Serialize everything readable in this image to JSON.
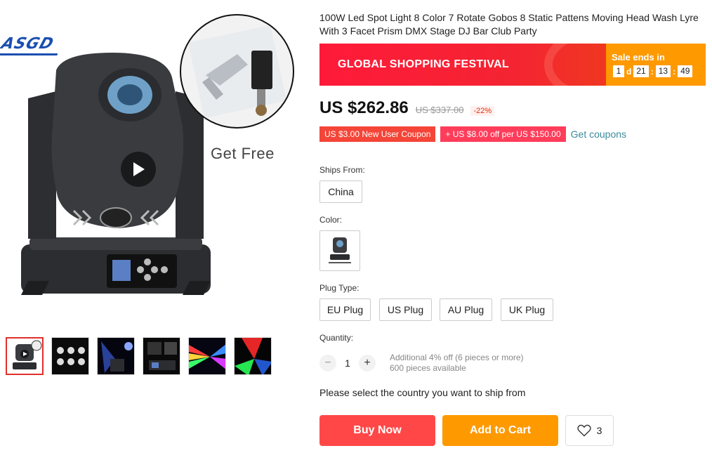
{
  "gallery": {
    "brand": "ASGD",
    "inset_caption": "Get Free",
    "thumbnails": [
      {
        "name": "thumb-moving-head"
      },
      {
        "name": "thumb-gobos"
      },
      {
        "name": "thumb-light-effect"
      },
      {
        "name": "thumb-display-panel"
      },
      {
        "name": "thumb-rainbow-beams"
      },
      {
        "name": "thumb-red-green-beams"
      }
    ]
  },
  "product": {
    "title": "100W Led Spot Light 8 Color 7 Rotate Gobos 8 Static Pattens Moving Head Wash Lyre With 3 Facet Prism DMX Stage DJ Bar Club Party"
  },
  "banner": {
    "title": "GLOBAL SHOPPING FESTIVAL",
    "sale_label": "Sale ends in",
    "days": "1",
    "days_unit": "d",
    "hours": "21",
    "minutes": "13",
    "seconds": "49",
    "sep": ":"
  },
  "price": {
    "current": "US $262.86",
    "original": "US $337.00",
    "discount": "-22%"
  },
  "coupons": {
    "new_user": "US $3.00 New User Coupon",
    "store": "+ US $8.00 off per US $150.00",
    "link": "Get coupons"
  },
  "ships_from": {
    "label": "Ships From:",
    "selected": "China"
  },
  "color": {
    "label": "Color:"
  },
  "plug": {
    "label": "Plug Type:",
    "options": [
      "EU Plug",
      "US Plug",
      "AU Plug",
      "UK Plug"
    ]
  },
  "quantity": {
    "label": "Quantity:",
    "minus": "−",
    "value": "1",
    "plus": "+",
    "extra_discount": "Additional 4% off (6 pieces or more)",
    "available": "600 pieces available"
  },
  "ship_note": "Please select the country you want to ship from",
  "actions": {
    "buy_now": "Buy Now",
    "add_to_cart": "Add to Cart",
    "wishlist_count": "3"
  },
  "colors": {
    "buy_now": "#ff4747",
    "add_to_cart": "#ff9900",
    "banner_red": "#f42432",
    "link": "#3a8a9b"
  }
}
